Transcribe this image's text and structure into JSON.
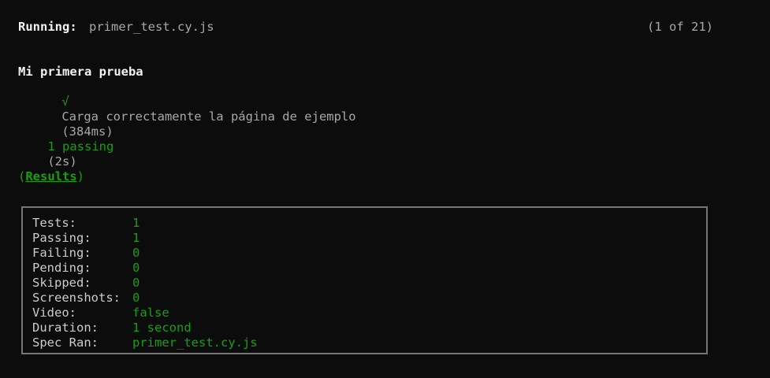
{
  "header": {
    "running_label": "Running:",
    "spec_file": "primer_test.cy.js",
    "spec_count": "(1 of 21)"
  },
  "suite": {
    "title": "Mi primera prueba",
    "tests": [
      {
        "check": "√",
        "name": "Carga correctamente la página de ejemplo",
        "duration": "(384ms)"
      }
    ]
  },
  "summary": {
    "passing": "1 passing",
    "time": "(2s)"
  },
  "results": {
    "open_paren": "(",
    "label": "Results",
    "close_paren": ")",
    "stats": [
      {
        "label": "Tests:",
        "value": "1"
      },
      {
        "label": "Passing:",
        "value": "1"
      },
      {
        "label": "Failing:",
        "value": "0"
      },
      {
        "label": "Pending:",
        "value": "0"
      },
      {
        "label": "Skipped:",
        "value": "0"
      },
      {
        "label": "Screenshots:",
        "value": "0"
      },
      {
        "label": "Video:",
        "value": "false"
      },
      {
        "label": "Duration:",
        "value": "1 second"
      },
      {
        "label": "Spec Ran:",
        "value": "primer_test.cy.js"
      }
    ]
  },
  "colors": {
    "background": "#0c0c0c",
    "text": "#cccccc",
    "success": "#13a10e",
    "border": "#767676"
  }
}
